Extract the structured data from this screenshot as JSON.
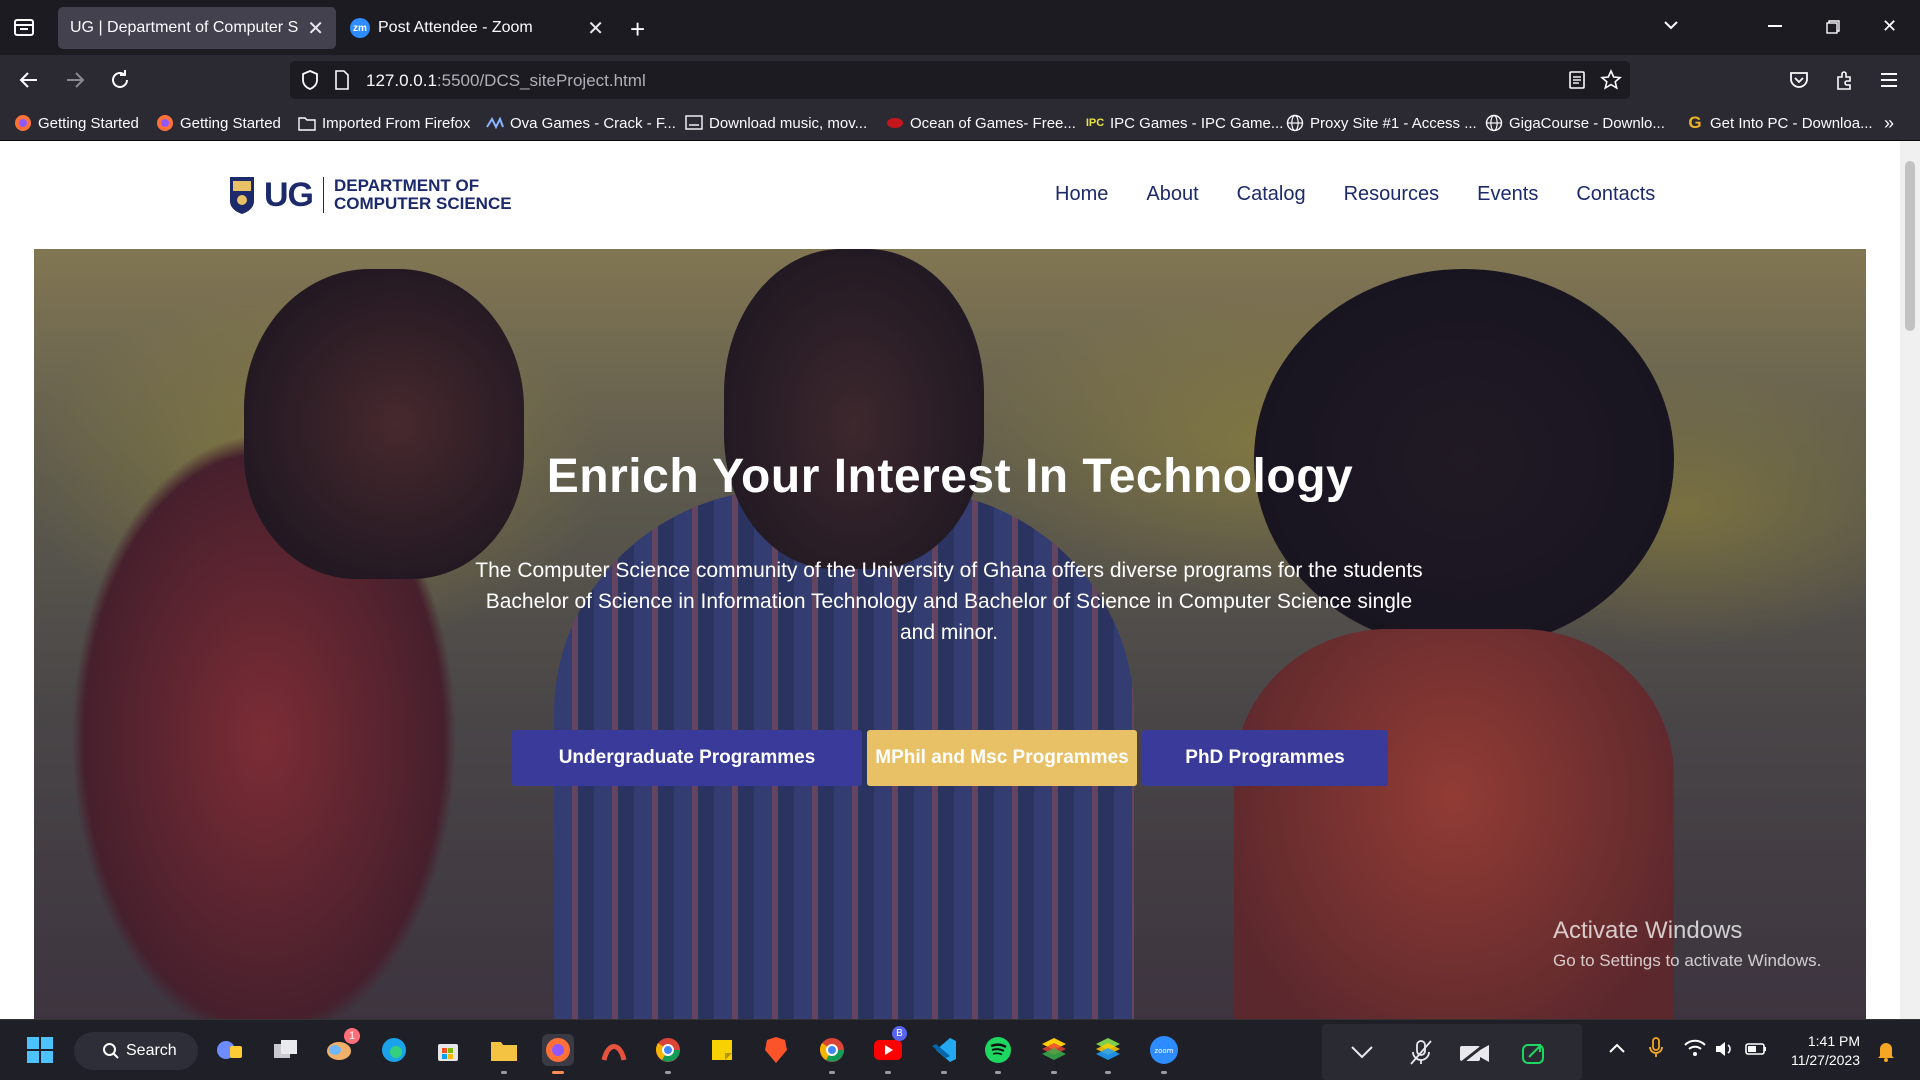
{
  "browser": {
    "tabs": [
      {
        "title": "UG | Department of Computer Scien",
        "active": true
      },
      {
        "title": "Post Attendee - Zoom",
        "active": false
      }
    ],
    "url": {
      "host": "127.0.0.1",
      "rest": ":5500/DCS_siteProject.html"
    },
    "bookmarks": [
      {
        "label": "Getting Started",
        "icon": "firefox-icon"
      },
      {
        "label": "Getting Started",
        "icon": "firefox-icon"
      },
      {
        "label": "Imported From Firefox",
        "icon": "folder-icon"
      },
      {
        "label": "Ova Games - Crack - F...",
        "icon": "ova-icon"
      },
      {
        "label": "Download music, mov...",
        "icon": "download-icon"
      },
      {
        "label": "Ocean of Games- Free...",
        "icon": "ocean-icon"
      },
      {
        "label": "IPC Games - IPC Game...",
        "icon": "ipc-icon"
      },
      {
        "label": "Proxy Site #1 - Access ...",
        "icon": "globe-icon"
      },
      {
        "label": "GigaCourse - Downlo...",
        "icon": "globe-icon"
      },
      {
        "label": "Get Into PC - Downloa...",
        "icon": "g-icon"
      }
    ]
  },
  "site": {
    "logo": {
      "mark": "UG",
      "line1": "DEPARTMENT OF",
      "line2": "COMPUTER SCIENCE"
    },
    "nav": [
      "Home",
      "About",
      "Catalog",
      "Resources",
      "Events",
      "Contacts"
    ],
    "hero": {
      "title": "Enrich Your Interest In Technology",
      "description": "The Computer Science community of the University of Ghana offers diverse programs for the students Bachelor of Science in Information Technology and Bachelor of Science in Computer Science single and minor.",
      "buttons": [
        "Undergraduate Programmes",
        "MPhil and Msc Programmes",
        "PhD Programmes"
      ]
    },
    "watermark": {
      "title": "Activate Windows",
      "subtitle": "Go to Settings to activate Windows."
    }
  },
  "taskbar": {
    "search_label": "Search",
    "time": "1:41 PM",
    "date": "11/27/2023",
    "notification_badge": "1",
    "profile_badge": "B"
  },
  "colors": {
    "accent_blue": "#3a3a9a",
    "accent_gold": "#e8c065",
    "brand_navy": "#1c2a6b"
  }
}
